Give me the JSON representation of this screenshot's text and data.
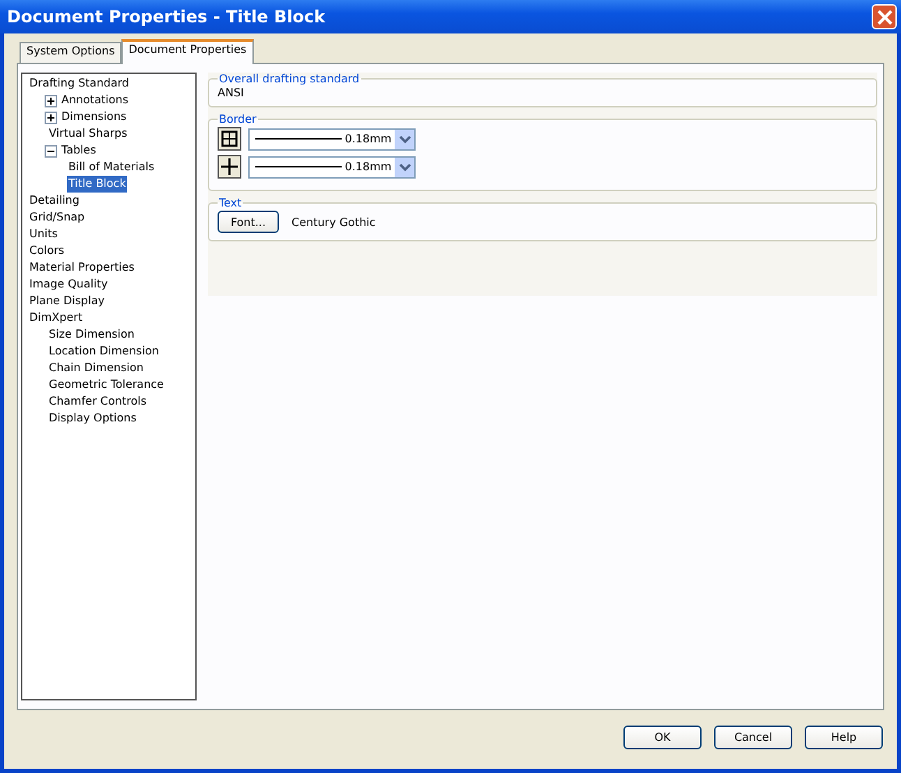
{
  "window": {
    "title": "Document Properties - Title Block"
  },
  "tabs": [
    {
      "label": "System Options",
      "selected": false
    },
    {
      "label": "Document Properties",
      "selected": true
    }
  ],
  "tree": [
    {
      "label": "Drafting Standard",
      "selected": false,
      "children": [
        {
          "label": "Annotations",
          "selected": false,
          "expanded": false
        },
        {
          "label": "Dimensions",
          "selected": false,
          "expanded": false
        },
        {
          "label": "Virtual Sharps",
          "selected": false
        },
        {
          "label": "Tables",
          "selected": false,
          "expanded": true,
          "children": [
            {
              "label": "Bill of Materials",
              "selected": false
            },
            {
              "label": "Title Block",
              "selected": true
            }
          ]
        }
      ]
    },
    {
      "label": "Detailing",
      "selected": false
    },
    {
      "label": "Grid/Snap",
      "selected": false
    },
    {
      "label": "Units",
      "selected": false
    },
    {
      "label": "Colors",
      "selected": false
    },
    {
      "label": "Material Properties",
      "selected": false
    },
    {
      "label": "Image Quality",
      "selected": false
    },
    {
      "label": "Plane Display",
      "selected": false
    },
    {
      "label": "DimXpert",
      "selected": false,
      "children": [
        {
          "label": "Size Dimension",
          "selected": false
        },
        {
          "label": "Location Dimension",
          "selected": false
        },
        {
          "label": "Chain Dimension",
          "selected": false
        },
        {
          "label": "Geometric Tolerance",
          "selected": false
        },
        {
          "label": "Chamfer Controls",
          "selected": false
        },
        {
          "label": "Display Options",
          "selected": false
        }
      ]
    }
  ],
  "overall_standard": {
    "legend": "Overall drafting standard",
    "value": "ANSI"
  },
  "border": {
    "legend": "Border",
    "rows": [
      {
        "kind": "outer",
        "value": "0.18mm"
      },
      {
        "kind": "inner",
        "value": "0.18mm"
      }
    ]
  },
  "text": {
    "legend": "Text",
    "button": "Font...",
    "font": "Century Gothic"
  },
  "buttons": [
    "OK",
    "Cancel",
    "Help"
  ]
}
